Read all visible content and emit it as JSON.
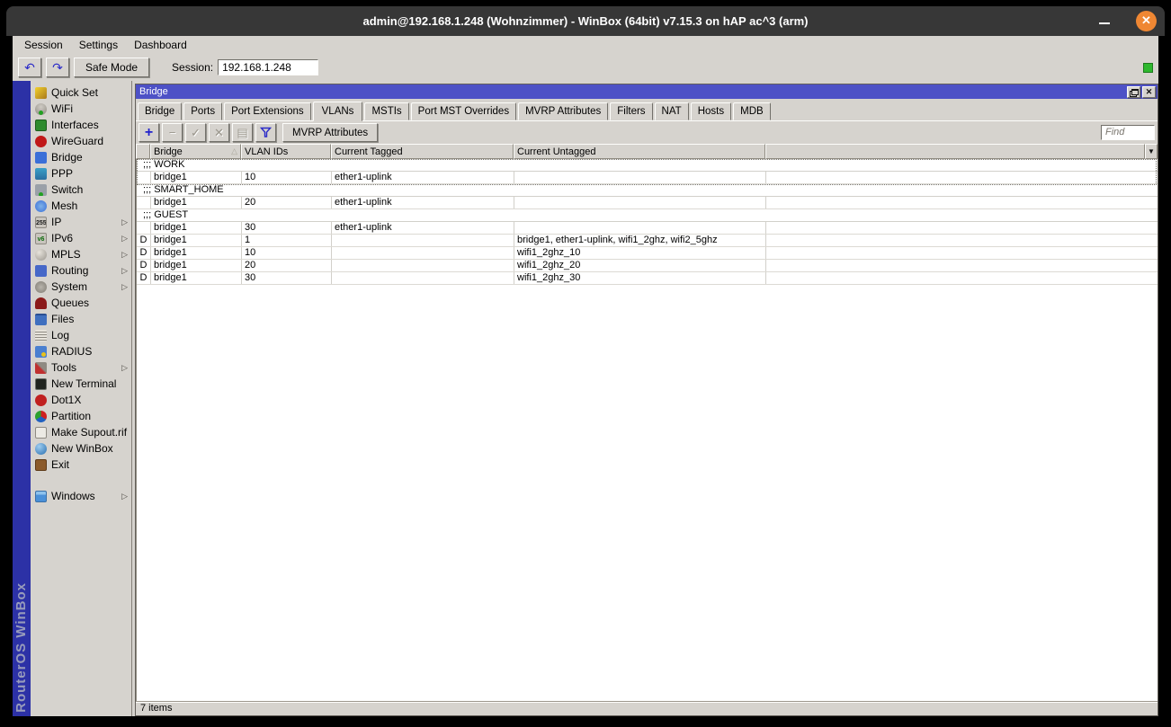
{
  "os_window": {
    "title": "admin@192.168.1.248 (Wohnzimmer) - WinBox (64bit) v7.15.3 on hAP ac^3 (arm)"
  },
  "menubar": {
    "items": [
      "Session",
      "Settings",
      "Dashboard"
    ]
  },
  "toolbar": {
    "safe_mode_label": "Safe Mode",
    "session_label": "Session:",
    "session_value": "192.168.1.248"
  },
  "sidebar": {
    "brand": "RouterOS WinBox",
    "items": [
      {
        "label": "Quick Set",
        "icon": "quick-set"
      },
      {
        "label": "WiFi",
        "icon": "wifi"
      },
      {
        "label": "Interfaces",
        "icon": "interfaces"
      },
      {
        "label": "WireGuard",
        "icon": "wireguard"
      },
      {
        "label": "Bridge",
        "icon": "bridge"
      },
      {
        "label": "PPP",
        "icon": "ppp"
      },
      {
        "label": "Switch",
        "icon": "switch"
      },
      {
        "label": "Mesh",
        "icon": "mesh"
      },
      {
        "label": "IP",
        "icon": "ip",
        "icon_glyph": "255",
        "arrow": true
      },
      {
        "label": "IPv6",
        "icon": "ipv6",
        "icon_glyph": "v6",
        "arrow": true
      },
      {
        "label": "MPLS",
        "icon": "mpls",
        "arrow": true
      },
      {
        "label": "Routing",
        "icon": "routing",
        "arrow": true
      },
      {
        "label": "System",
        "icon": "system",
        "arrow": true
      },
      {
        "label": "Queues",
        "icon": "queues"
      },
      {
        "label": "Files",
        "icon": "files"
      },
      {
        "label": "Log",
        "icon": "log"
      },
      {
        "label": "RADIUS",
        "icon": "radius"
      },
      {
        "label": "Tools",
        "icon": "tools",
        "arrow": true
      },
      {
        "label": "New Terminal",
        "icon": "new-terminal"
      },
      {
        "label": "Dot1X",
        "icon": "dot1x"
      },
      {
        "label": "Partition",
        "icon": "partition"
      },
      {
        "label": "Make Supout.rif",
        "icon": "make-supout"
      },
      {
        "label": "New WinBox",
        "icon": "new-winbox"
      },
      {
        "label": "Exit",
        "icon": "exit"
      },
      {
        "label": "Windows",
        "icon": "windows",
        "arrow": true,
        "gap_before": true
      }
    ]
  },
  "bridge_window": {
    "title": "Bridge",
    "tabs": [
      "Bridge",
      "Ports",
      "Port Extensions",
      "VLANs",
      "MSTIs",
      "Port MST Overrides",
      "MVRP Attributes",
      "Filters",
      "NAT",
      "Hosts",
      "MDB"
    ],
    "active_tab": "VLANs",
    "wtoolbar": {
      "mvrp_button": "MVRP Attributes",
      "find_placeholder": "Find"
    },
    "table": {
      "columns": [
        "Bridge",
        "VLAN IDs",
        "Current Tagged",
        "Current Untagged"
      ],
      "sorted_column": "Bridge",
      "rows": [
        {
          "type": "comment",
          "label": ";;; WORK",
          "focused": true
        },
        {
          "type": "item",
          "flags": "",
          "bridge": "bridge1",
          "vlan_ids": "10",
          "current_tagged": "ether1-uplink",
          "current_untagged": "",
          "focused": true
        },
        {
          "type": "comment",
          "label": ";;; SMART_HOME"
        },
        {
          "type": "item",
          "flags": "",
          "bridge": "bridge1",
          "vlan_ids": "20",
          "current_tagged": "ether1-uplink",
          "current_untagged": ""
        },
        {
          "type": "comment",
          "label": ";;; GUEST"
        },
        {
          "type": "item",
          "flags": "",
          "bridge": "bridge1",
          "vlan_ids": "30",
          "current_tagged": "ether1-uplink",
          "current_untagged": ""
        },
        {
          "type": "item",
          "flags": "D",
          "bridge": "bridge1",
          "vlan_ids": "1",
          "current_tagged": "",
          "current_untagged": "bridge1, ether1-uplink, wifi1_2ghz, wifi2_5ghz"
        },
        {
          "type": "item",
          "flags": "D",
          "bridge": "bridge1",
          "vlan_ids": "10",
          "current_tagged": "",
          "current_untagged": "wifi1_2ghz_10"
        },
        {
          "type": "item",
          "flags": "D",
          "bridge": "bridge1",
          "vlan_ids": "20",
          "current_tagged": "",
          "current_untagged": "wifi1_2ghz_20"
        },
        {
          "type": "item",
          "flags": "D",
          "bridge": "bridge1",
          "vlan_ids": "30",
          "current_tagged": "",
          "current_untagged": "wifi1_2ghz_30"
        }
      ]
    },
    "status": "7 items"
  },
  "glyphs": {
    "undo": "↶",
    "redo": "↷",
    "add": "+",
    "remove": "−",
    "enable": "✓",
    "disable": "✕",
    "comment": "▤",
    "dropdown": "▼",
    "sort_asc": "△",
    "submenu": "▷",
    "window_close": "✕",
    "app_close": "✕"
  },
  "colors": {
    "window_title_blue": "#4d51c6",
    "brand_strip_blue": "#2c31a6",
    "close_button_orange": "#ef8733",
    "indicator_green": "#2eb82e",
    "accent_blue": "#2222cc"
  }
}
